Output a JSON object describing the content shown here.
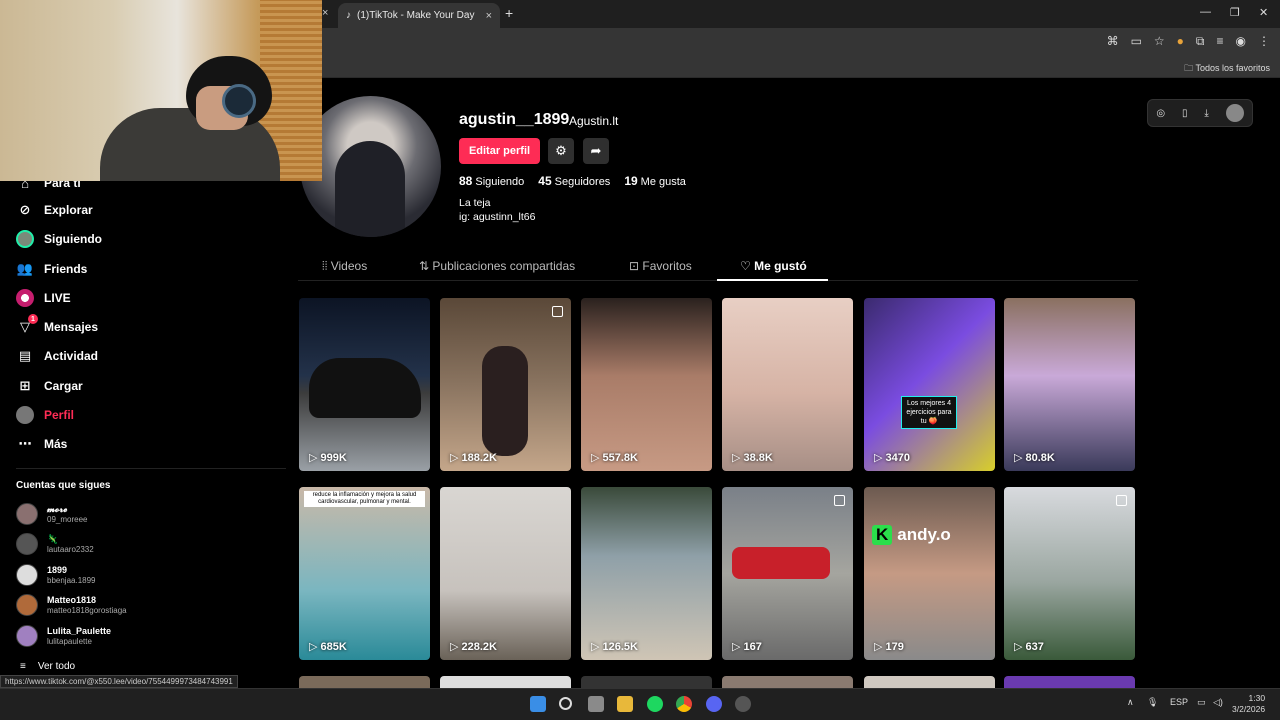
{
  "browser": {
    "tab_title": "(1)TikTok - Make Your Day",
    "tab_close": "×",
    "new_tab": "+",
    "bookmarks_all": "Todos los favoritos",
    "status_url": "https://www.tiktok.com/@x550.lee/video/7554499973484743991"
  },
  "sidebar": {
    "items": [
      {
        "label": "Para ti",
        "icon": "home-icon"
      },
      {
        "label": "Explorar",
        "icon": "compass-icon"
      },
      {
        "label": "Siguiendo",
        "icon": "following-avatar-icon"
      },
      {
        "label": "Friends",
        "icon": "friends-icon"
      },
      {
        "label": "LIVE",
        "icon": "live-icon"
      },
      {
        "label": "Mensajes",
        "icon": "messages-icon",
        "badge": "1"
      },
      {
        "label": "Actividad",
        "icon": "activity-icon"
      },
      {
        "label": "Cargar",
        "icon": "upload-icon"
      },
      {
        "label": "Perfil",
        "icon": "profile-avatar-icon"
      },
      {
        "label": "Más",
        "icon": "more-icon"
      }
    ],
    "following_title": "Cuentas que sigues",
    "following": [
      {
        "name": "𝓶𝓸𝓻𝓮",
        "username": "09_moreee"
      },
      {
        "name": "🦎",
        "username": "lautaaro2332"
      },
      {
        "name": "1899",
        "username": "bbenjaa.1899"
      },
      {
        "name": "Matteo1818",
        "username": "matteo1818gorostiaga"
      },
      {
        "name": "Lulita_Paulette",
        "username": "lulitapaulette"
      }
    ],
    "see_all": "Ver todo"
  },
  "profile": {
    "username": "agustin__1899",
    "display_name": "Agustin.lt",
    "edit_button": "Editar perfil",
    "following_count": "88",
    "following_label": "Siguiendo",
    "followers_count": "45",
    "followers_label": "Seguidores",
    "likes_count": "19",
    "likes_label": "Me gusta",
    "bio_line1": "La teja",
    "bio_line2": "ig: agustinn_lt66"
  },
  "tabs": [
    {
      "label": "Videos",
      "icon": "grid-icon"
    },
    {
      "label": "Publicaciones compartidas",
      "icon": "repost-icon"
    },
    {
      "label": "Favoritos",
      "icon": "bookmark-icon"
    },
    {
      "label": "Me gustó",
      "icon": "heart-icon",
      "active": true
    }
  ],
  "videos": [
    {
      "views": "999K"
    },
    {
      "views": "188.2K",
      "multi": true
    },
    {
      "views": "557.8K"
    },
    {
      "views": "38.8K"
    },
    {
      "views": "3470",
      "overlay": "Los mejores 4 ejercicios para tu 🍑"
    },
    {
      "views": "80.8K"
    },
    {
      "views": "685K",
      "caption": "reduce la inflamación y mejora la salud cardiovascular, pulmonar y mental."
    },
    {
      "views": "228.2K"
    },
    {
      "views": "126.5K"
    },
    {
      "views": "167",
      "multi": true
    },
    {
      "views": "179",
      "logo": "andy.o"
    },
    {
      "views": "637",
      "multi": true
    }
  ],
  "taskbar": {
    "lang": "ESP",
    "time": "1:30",
    "date": "3/2/2026"
  },
  "colors": {
    "accent": "#fe2c55",
    "background": "#000000"
  }
}
